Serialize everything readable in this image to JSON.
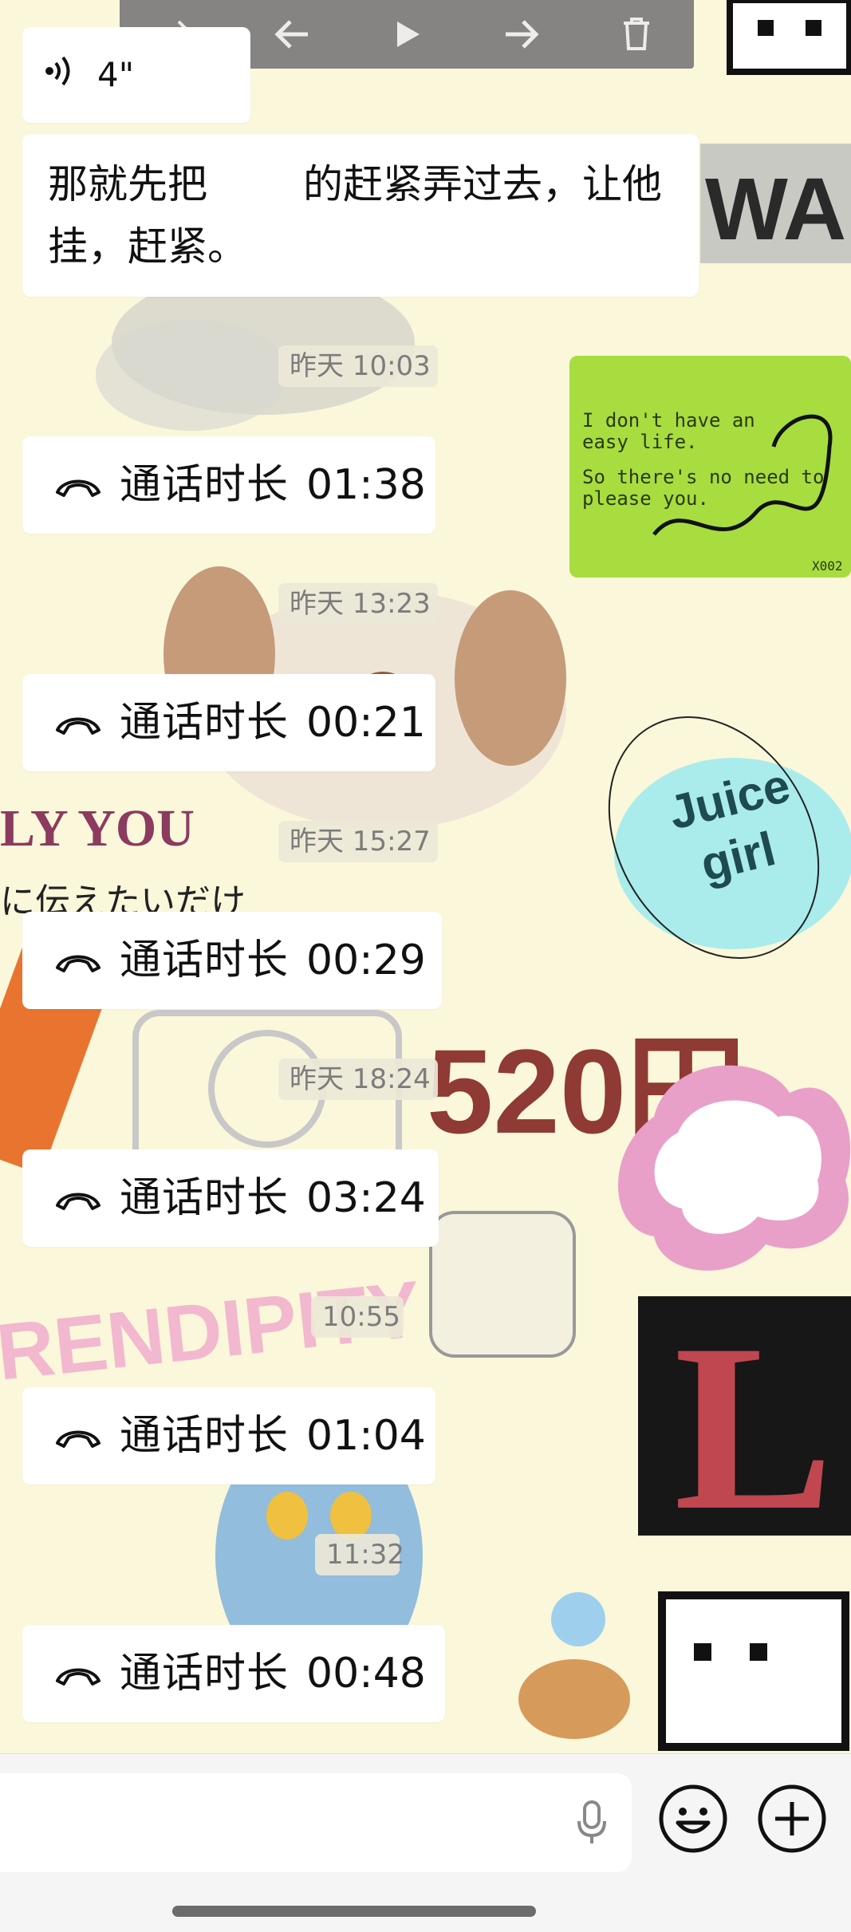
{
  "voice_message": {
    "duration": "4\""
  },
  "text_message": {
    "line1_before": "那就先把",
    "line1_after": "的赶紧弄过去，让他",
    "line2": "挂，赶紧。"
  },
  "messages": [
    {
      "timestamp": "昨天 10:03",
      "call_label": "通话时长",
      "call_duration": "01:38"
    },
    {
      "timestamp": "昨天 13:23",
      "call_label": "通话时长",
      "call_duration": "00:21"
    },
    {
      "timestamp": "昨天 15:27",
      "call_label": "通话时长",
      "call_duration": "00:29"
    },
    {
      "timestamp": "昨天 18:24",
      "call_label": "通话时长",
      "call_duration": "03:24"
    },
    {
      "timestamp": "10:55",
      "call_label": "通话时长",
      "call_duration": "01:04"
    },
    {
      "timestamp": "11:32",
      "call_label": "通话时长",
      "call_duration": "00:48"
    }
  ],
  "wallpaper_text": {
    "sticker_line1": "I don't have an",
    "sticker_line2": "easy life.",
    "sticker_line3": "So there's no need to",
    "sticker_line4": "please you.",
    "sticker_code": "X002",
    "juice1": "Juice",
    "juice2": "girl",
    "yen": "520円",
    "wait": "WAIT,",
    "only_you": "LY YOU",
    "japanese": "に伝えたいだけ",
    "serendipity": "RENDIPITY",
    "big_letter": "L"
  },
  "icons": {
    "toolbar": [
      "share-icon",
      "back-arrow-icon",
      "play-icon",
      "forward-arrow-icon",
      "trash-icon"
    ],
    "voice": "voice-wave-icon",
    "call": "phone-hangup-icon",
    "input": [
      "mic-icon",
      "emoji-icon",
      "plus-icon"
    ]
  },
  "colors": {
    "background": "#fbf7da",
    "bubble": "#ffffff",
    "timestamp_bg": "#ebe8d7",
    "timestamp_text": "#7c7c7c"
  }
}
